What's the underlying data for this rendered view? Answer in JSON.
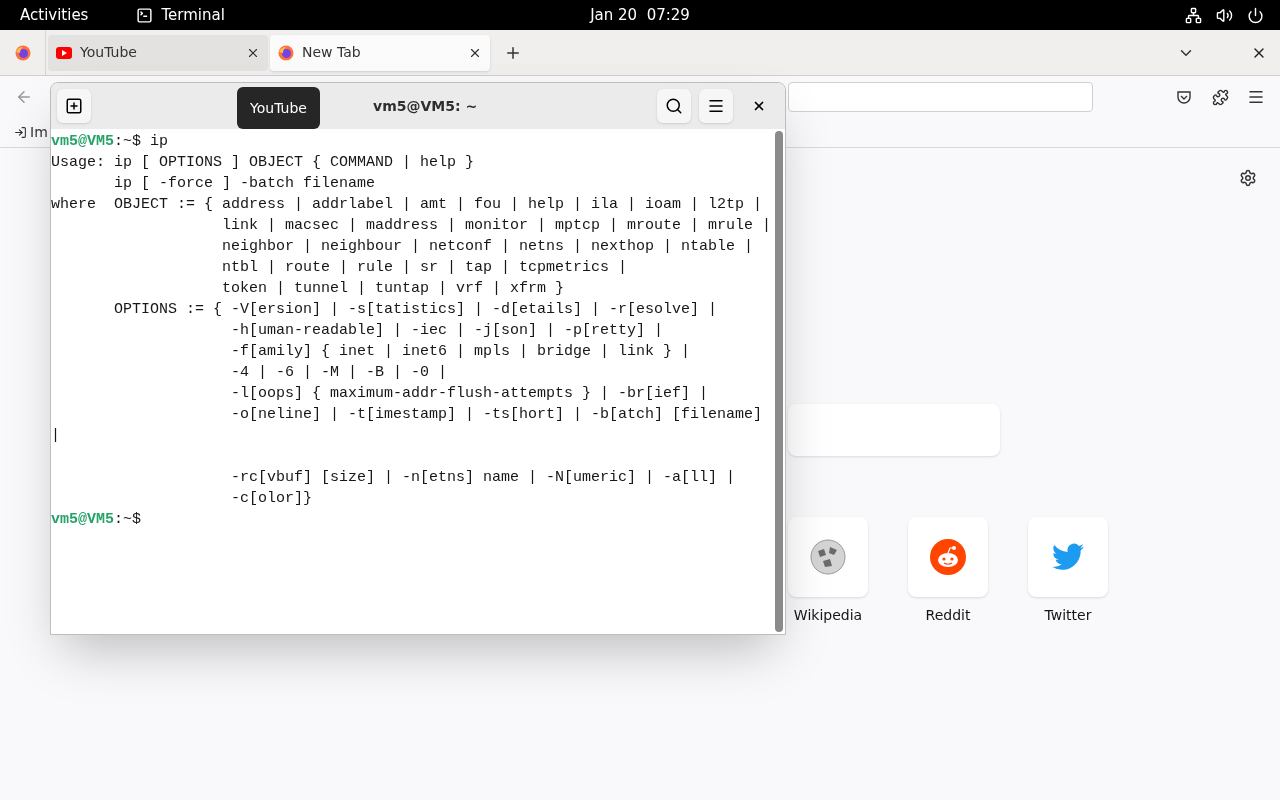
{
  "top_bar": {
    "activities": "Activities",
    "app": "Terminal",
    "clock": "Jan 20  07:29"
  },
  "browser": {
    "tabs": [
      {
        "title": "YouTube",
        "selected": false,
        "kind": "youtube"
      },
      {
        "title": "New Tab",
        "selected": true,
        "kind": "firefox"
      }
    ],
    "bookmarks_bar": {
      "import_label": "Im"
    },
    "shortcuts": [
      {
        "label": "Wikipedia",
        "kind": "wikipedia"
      },
      {
        "label": "Reddit",
        "kind": "reddit"
      },
      {
        "label": "Twitter",
        "kind": "twitter"
      }
    ]
  },
  "terminal": {
    "title": "vm5@VM5: ~",
    "tooltip": "YouTube",
    "lines": [
      {
        "kind": "prompt",
        "user": "vm5@VM5",
        "path": ":~$",
        "command": "ip"
      },
      {
        "kind": "output",
        "text": "Usage: ip [ OPTIONS ] OBJECT { COMMAND | help }"
      },
      {
        "kind": "output",
        "text": "       ip [ -force ] -batch filename"
      },
      {
        "kind": "output",
        "text": "where  OBJECT := { address | addrlabel | amt | fou | help | ila | ioam | l2tp |"
      },
      {
        "kind": "output",
        "text": "                   link | macsec | maddress | monitor | mptcp | mroute | mrule |"
      },
      {
        "kind": "output",
        "text": "                   neighbor | neighbour | netconf | netns | nexthop | ntable |"
      },
      {
        "kind": "output",
        "text": "                   ntbl | route | rule | sr | tap | tcpmetrics |"
      },
      {
        "kind": "output",
        "text": "                   token | tunnel | tuntap | vrf | xfrm }"
      },
      {
        "kind": "output",
        "text": "       OPTIONS := { -V[ersion] | -s[tatistics] | -d[etails] | -r[esolve] |"
      },
      {
        "kind": "output",
        "text": "                    -h[uman-readable] | -iec | -j[son] | -p[retty] |"
      },
      {
        "kind": "output",
        "text": "                    -f[amily] { inet | inet6 | mpls | bridge | link } |"
      },
      {
        "kind": "output",
        "text": "                    -4 | -6 | -M | -B | -0 |"
      },
      {
        "kind": "output",
        "text": "                    -l[oops] { maximum-addr-flush-attempts } | -br[ief] |"
      },
      {
        "kind": "output",
        "text": "                    -o[neline] | -t[imestamp] | -ts[hort] | -b[atch] [filename]"
      },
      {
        "kind": "output",
        "text": "|"
      },
      {
        "kind": "blank"
      },
      {
        "kind": "output",
        "text": "                    -rc[vbuf] [size] | -n[etns] name | -N[umeric] | -a[ll] |"
      },
      {
        "kind": "output",
        "text": "                    -c[olor]}"
      },
      {
        "kind": "prompt",
        "user": "vm5@VM5",
        "path": ":~$"
      }
    ]
  }
}
